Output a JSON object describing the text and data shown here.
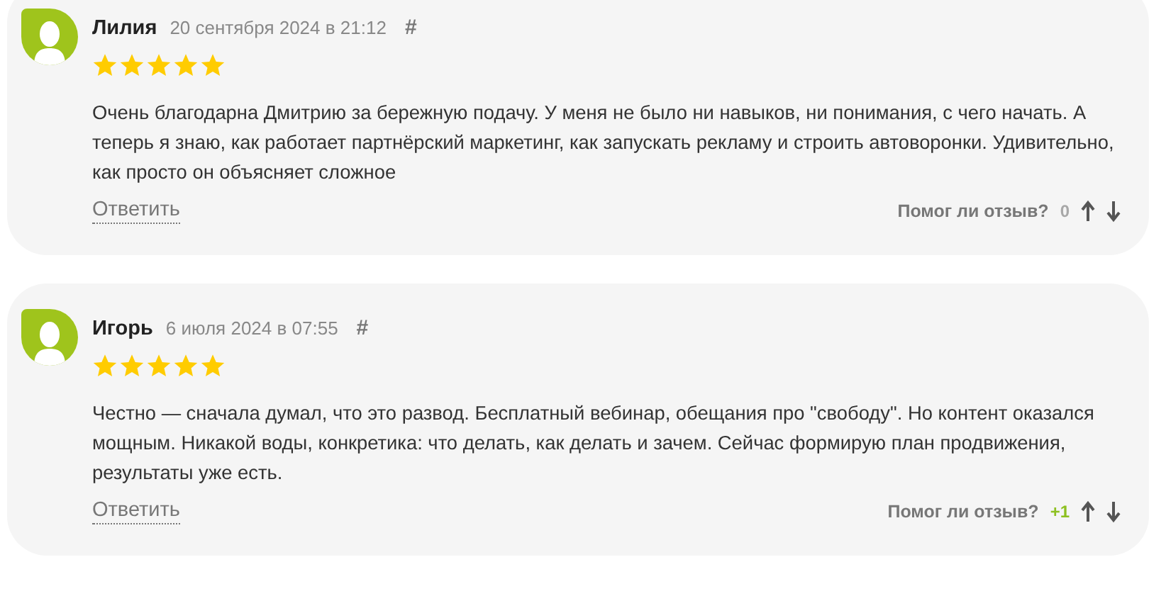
{
  "reviews": [
    {
      "author": "Лилия",
      "date": "20 сентября 2024 в 21:12",
      "anchor": "#",
      "stars": 5,
      "text": "Очень благодарна Дмитрию за бережную подачу. У меня не было ни навыков, ни понимания, с чего начать. А теперь я знаю, как работает партнёрский маркетинг, как запускать рекламу и строить автоворонки. Удивительно, как просто он объясняет сложное",
      "reply": "Ответить",
      "helpful_label": "Помог ли отзыв?",
      "score": "0",
      "positive": false
    },
    {
      "author": "Игорь",
      "date": "6 июля 2024 в 07:55",
      "anchor": "#",
      "stars": 5,
      "text": "Честно — сначала думал, что это развод. Бесплатный вебинар, обещания про \"свободу\". Но контент оказался мощным. Никакой воды, конкретика: что делать, как делать и зачем. Сейчас формирую план продвижения, результаты уже есть.",
      "reply": "Ответить",
      "helpful_label": "Помог ли отзыв?",
      "score": "+1",
      "positive": true
    }
  ]
}
